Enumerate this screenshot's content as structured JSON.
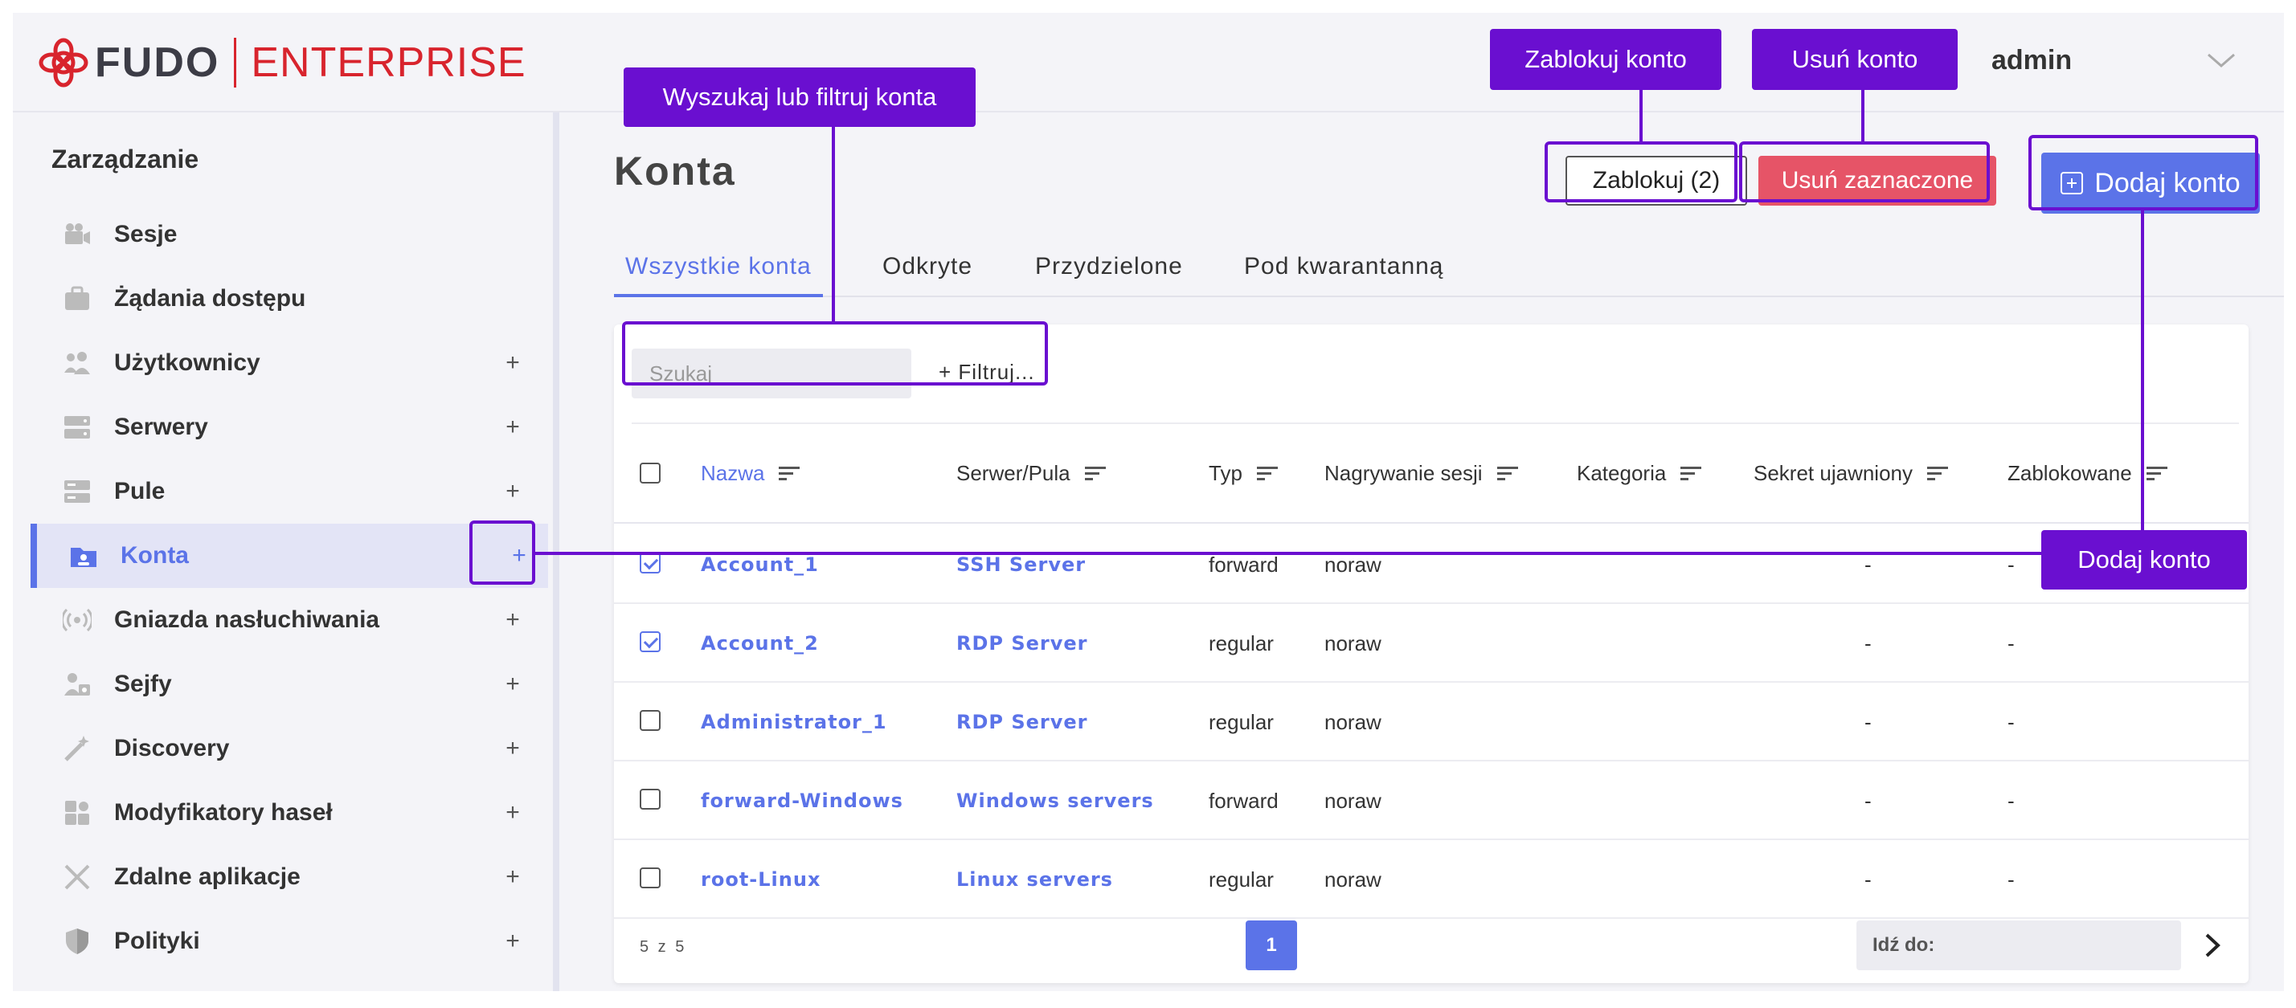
{
  "brand": {
    "name": "FUDO",
    "product": "ENTERPRISE"
  },
  "user": {
    "name": "admin"
  },
  "sidebar": {
    "heading": "Zarządzanie",
    "items": [
      {
        "label": "Sesje",
        "icon": "camera-icon",
        "plus": ""
      },
      {
        "label": "Żądania dostępu",
        "icon": "briefcase-icon",
        "plus": ""
      },
      {
        "label": "Użytkownicy",
        "icon": "users-icon",
        "plus": "+"
      },
      {
        "label": "Serwery",
        "icon": "server-icon",
        "plus": "+"
      },
      {
        "label": "Pule",
        "icon": "pool-icon",
        "plus": "+"
      },
      {
        "label": "Konta",
        "icon": "account-folder-icon",
        "plus": "+"
      },
      {
        "label": "Gniazda nasłuchiwania",
        "icon": "broadcast-icon",
        "plus": "+"
      },
      {
        "label": "Sejfy",
        "icon": "safe-user-icon",
        "plus": "+"
      },
      {
        "label": "Discovery",
        "icon": "magic-wand-icon",
        "plus": "+"
      },
      {
        "label": "Modyfikatory haseł",
        "icon": "puzzle-icon",
        "plus": "+"
      },
      {
        "label": "Zdalne aplikacje",
        "icon": "tools-icon",
        "plus": "+"
      },
      {
        "label": "Polityki",
        "icon": "shield-icon",
        "plus": "+"
      }
    ]
  },
  "main": {
    "title": "Konta",
    "buttons": {
      "lock": "Zablokuj (2)",
      "delete": "Usuń zaznaczone",
      "add": "Dodaj konto"
    },
    "tabs": [
      "Wszystkie konta",
      "Odkryte",
      "Przydzielone",
      "Pod kwarantanną"
    ],
    "search": {
      "placeholder": "Szukaj",
      "filter": "+ Filtruj..."
    },
    "table": {
      "columns": [
        "Nazwa",
        "Serwer/Pula",
        "Typ",
        "Nagrywanie sesji",
        "Kategoria",
        "Sekret ujawniony",
        "Zablokowane"
      ],
      "rows": [
        {
          "checked": true,
          "name": "Account_1",
          "server": "SSH Server",
          "type": "forward",
          "recording": "noraw",
          "category": "",
          "secret": "-",
          "locked": "-"
        },
        {
          "checked": true,
          "name": "Account_2",
          "server": "RDP Server",
          "type": "regular",
          "recording": "noraw",
          "category": "",
          "secret": "-",
          "locked": "-"
        },
        {
          "checked": false,
          "name": "Administrator_1",
          "server": "RDP Server",
          "type": "regular",
          "recording": "noraw",
          "category": "",
          "secret": "-",
          "locked": "-"
        },
        {
          "checked": false,
          "name": "forward-Windows",
          "server": "Windows servers",
          "type": "forward",
          "recording": "noraw",
          "category": "",
          "secret": "-",
          "locked": "-"
        },
        {
          "checked": false,
          "name": "root-Linux",
          "server": "Linux servers",
          "type": "regular",
          "recording": "noraw",
          "category": "",
          "secret": "-",
          "locked": "-"
        }
      ]
    },
    "pagination": {
      "count": "5 z 5",
      "current": "1",
      "goto_placeholder": "Idź do:"
    }
  },
  "annotations": {
    "search": "Wyszukaj lub filtruj konta",
    "lock": "Zablokuj konto",
    "delete": "Usuń konto",
    "add": "Dodaj konto"
  },
  "colors": {
    "accent": "#5b73e8",
    "danger": "#e65467",
    "annotation": "#6a0fd0",
    "brand_red": "#d8242d"
  }
}
